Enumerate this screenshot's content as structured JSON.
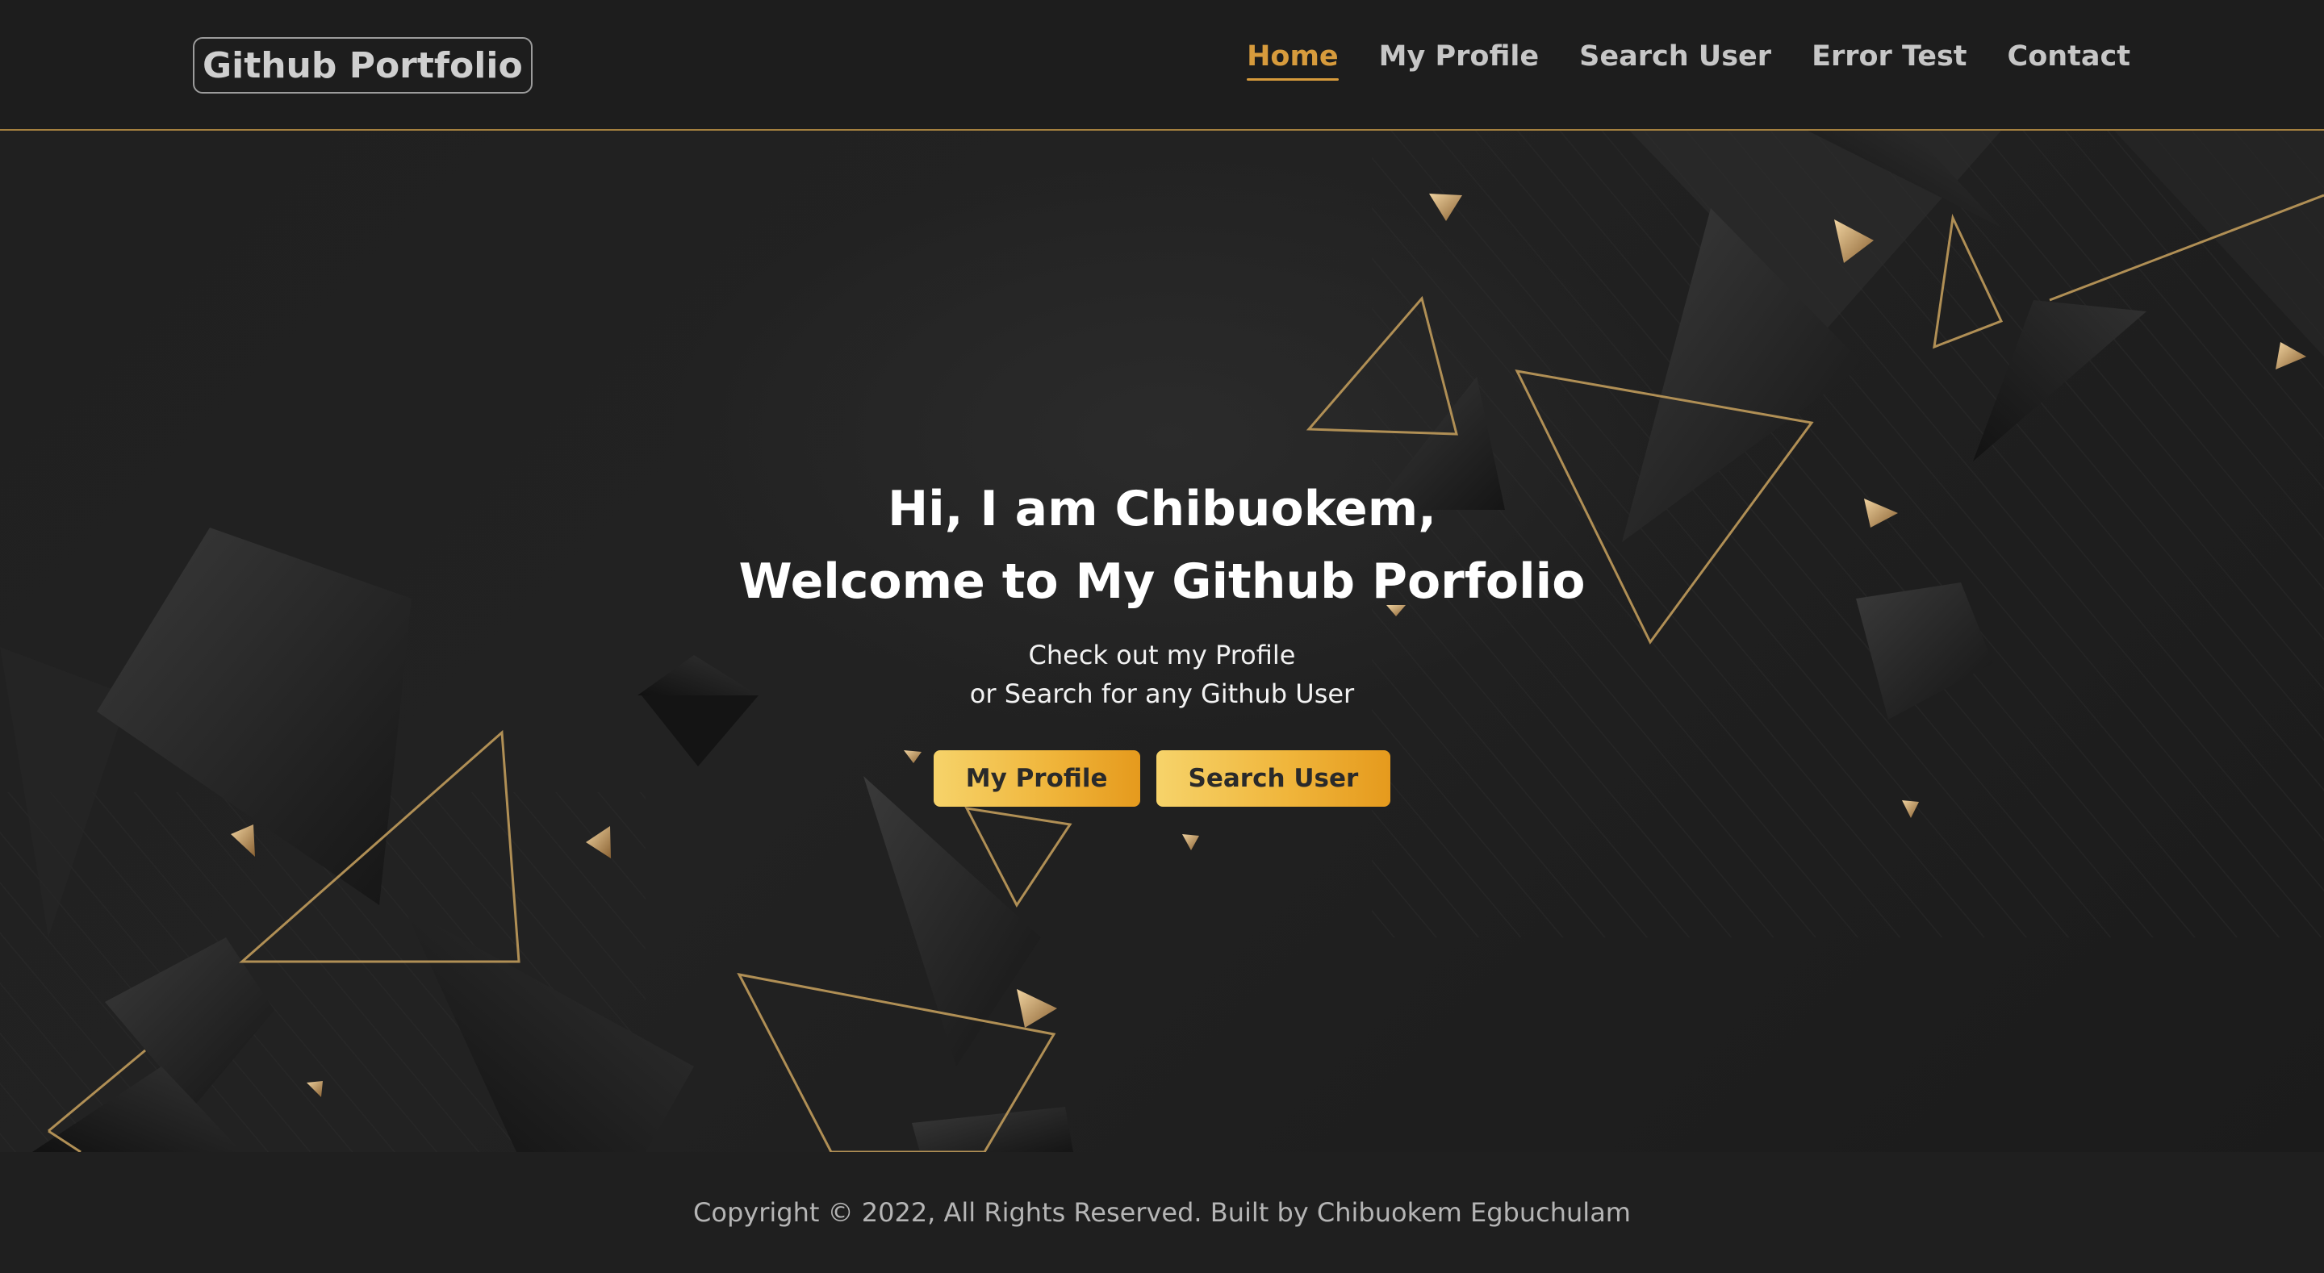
{
  "navbar": {
    "brand": "Github Portfolio",
    "links": [
      {
        "label": "Home",
        "active": true
      },
      {
        "label": "My Profile",
        "active": false
      },
      {
        "label": "Search User",
        "active": false
      },
      {
        "label": "Error Test",
        "active": false
      },
      {
        "label": "Contact",
        "active": false
      }
    ]
  },
  "hero": {
    "title_line1": "Hi, I am Chibuokem,",
    "title_line2": "Welcome to My Github Porfolio",
    "sub_line1": "Check out my Profile",
    "sub_line2": "or Search for any Github User",
    "buttons": {
      "profile": "My Profile",
      "search": "Search User"
    },
    "background_decoration": "triangle-shapes"
  },
  "footer": {
    "copyright": "Copyright © 2022, All Rights Reserved. Built by Chibuokem Egbuchulam"
  },
  "colors": {
    "accent": "#d79b3c",
    "button_gradient_start": "#f6d36a",
    "button_gradient_end": "#e59a1d",
    "background": "#1c1c1c",
    "gold_outline": "#b08f55"
  }
}
